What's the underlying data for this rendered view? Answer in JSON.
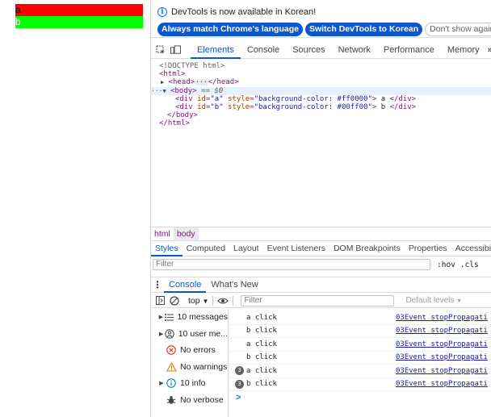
{
  "page": {
    "div_a_text": "a",
    "div_b_text": "b",
    "div_a_color": "#ff0000",
    "div_b_color": "#00ff00"
  },
  "infobar": {
    "message": "DevTools is now available in Korean!",
    "btn_match": "Always match Chrome's language",
    "btn_switch": "Switch DevTools to Korean",
    "btn_dont_show": "Don't show again"
  },
  "main_tabs": [
    "Elements",
    "Console",
    "Sources",
    "Network",
    "Performance",
    "Memory"
  ],
  "main_tabs_more": "»",
  "dom": {
    "doctype": "<!DOCTYPE html>",
    "html_open": "<html>",
    "head_open": "<head>",
    "head_ellipsis": "···",
    "head_close": "</head>",
    "body_open": "<body>",
    "body_eq": "== $0",
    "div_open": "<div",
    "id_attr": "id",
    "id_a_val": "\"a\"",
    "id_b_val": "\"b\"",
    "style_attr": "style",
    "style_a_val": "\"background-color: #ff0000\"",
    "style_b_val": "\"background-color: #00ff00\"",
    "tag_gt": ">",
    "div_a_text": " a ",
    "div_b_text": " b ",
    "div_close": "</div>",
    "body_close": "</body>",
    "html_close": "</html>"
  },
  "breadcrumbs": [
    "html",
    "body"
  ],
  "styles_tabs": [
    "Styles",
    "Computed",
    "Layout",
    "Event Listeners",
    "DOM Breakpoints",
    "Properties",
    "Accessibilit"
  ],
  "styles_filter": {
    "placeholder": "Filter",
    "hov": ":hov",
    "cls": ".cls"
  },
  "drawer_tabs": [
    "Console",
    "What's New"
  ],
  "console_toolbar": {
    "context": "top",
    "filter_placeholder": "Filter",
    "levels": "Default levels"
  },
  "sidebar": [
    {
      "label": "10 messages",
      "icon": "list-icon",
      "arrow": true
    },
    {
      "label": "10 user me...",
      "icon": "user-icon",
      "arrow": true
    },
    {
      "label": "No errors",
      "icon": "error-icon",
      "arrow": false
    },
    {
      "label": "No warnings",
      "icon": "warning-icon",
      "arrow": false
    },
    {
      "label": "10 info",
      "icon": "info-icon",
      "arrow": true
    },
    {
      "label": "No verbose",
      "icon": "bug-icon",
      "arrow": false
    }
  ],
  "messages": [
    {
      "count": "",
      "text": "a click",
      "source": "03Event_stopPropagati"
    },
    {
      "count": "",
      "text": "b click",
      "source": "03Event_stopPropagati"
    },
    {
      "count": "",
      "text": "a click",
      "source": "03Event_stopPropagati"
    },
    {
      "count": "",
      "text": "b click",
      "source": "03Event_stopPropagati"
    },
    {
      "count": "3",
      "text": "a click",
      "source": "03Event_stopPropagati"
    },
    {
      "count": "3",
      "text": "b click",
      "source": "03Event_stopPropagati"
    }
  ],
  "console_prompt": ">",
  "colors": {
    "accent": "#0b57d0",
    "error": "#d93025",
    "warning": "#e37400",
    "info": "#1a73e8"
  }
}
